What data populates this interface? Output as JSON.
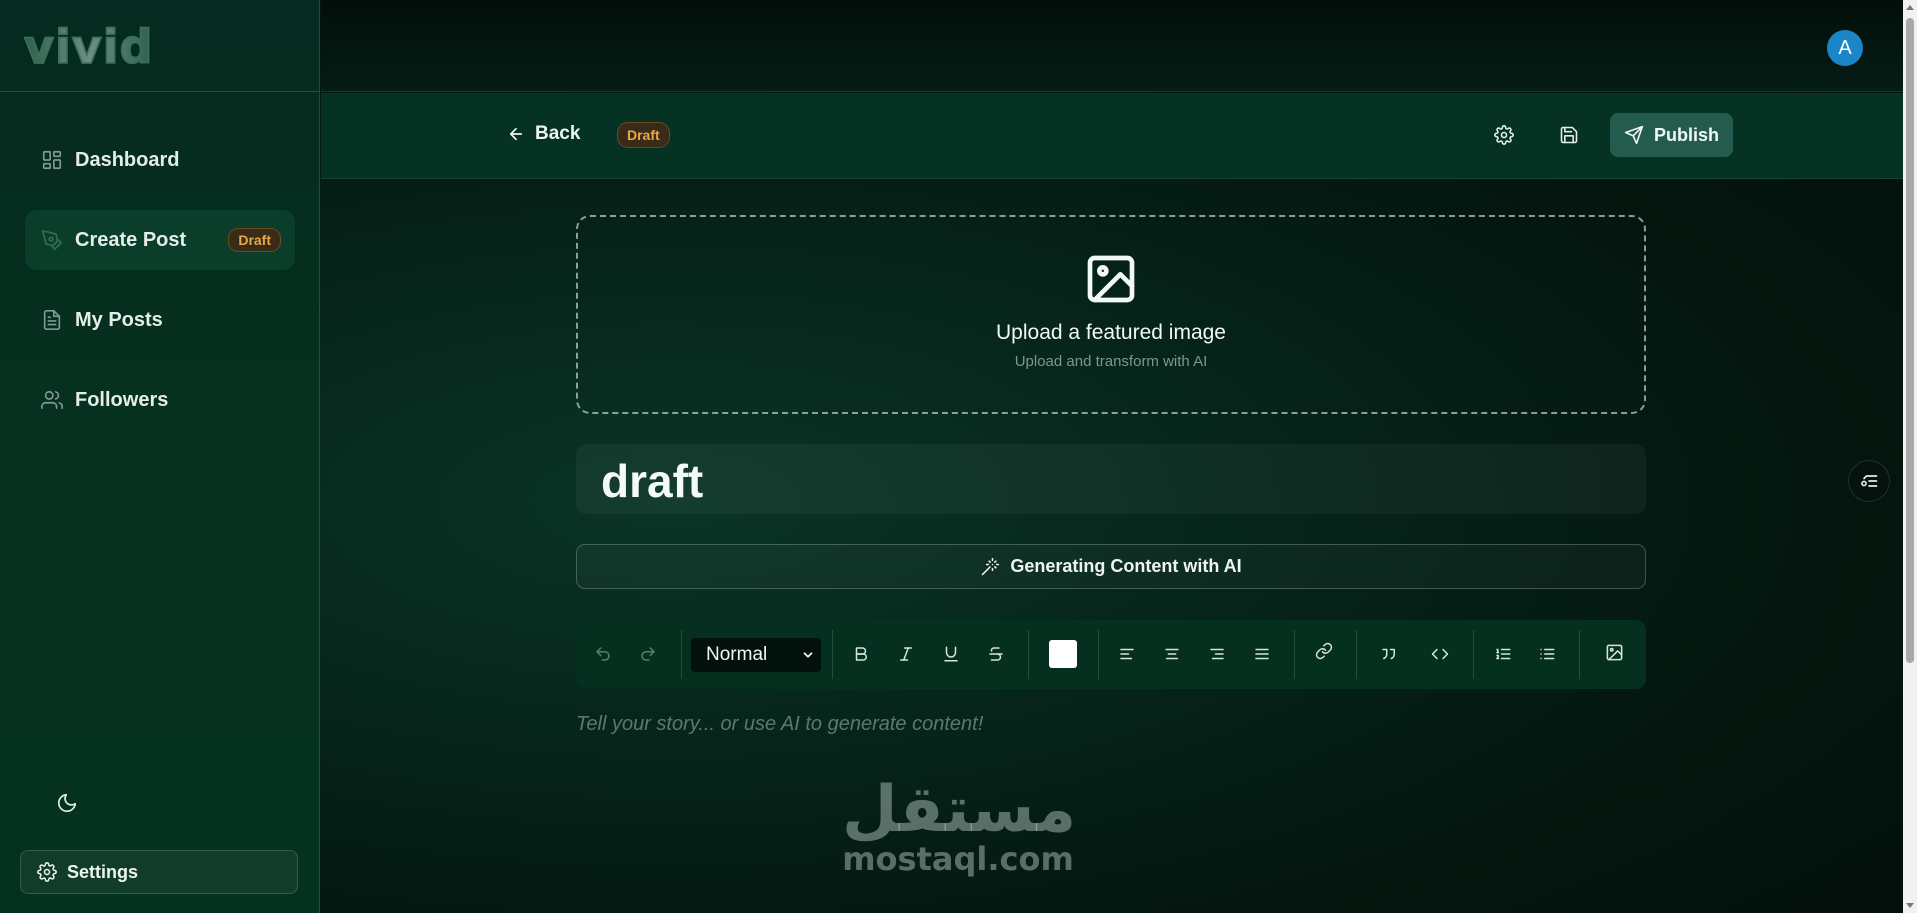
{
  "app": {
    "logo_text": "vivid"
  },
  "sidebar": {
    "items": [
      {
        "label": "Dashboard",
        "icon": "dashboard-icon"
      },
      {
        "label": "Create Post",
        "icon": "pen-icon",
        "badge": "Draft",
        "active": true
      },
      {
        "label": "My Posts",
        "icon": "document-icon"
      },
      {
        "label": "Followers",
        "icon": "users-icon"
      }
    ],
    "theme_toggle_icon": "moon-icon",
    "settings_label": "Settings"
  },
  "topbar": {
    "avatar_initial": "A"
  },
  "editor_header": {
    "back_label": "Back",
    "status_badge": "Draft",
    "publish_label": "Publish"
  },
  "upload": {
    "title": "Upload a featured image",
    "subtitle": "Upload and transform with AI"
  },
  "post": {
    "title": "draft"
  },
  "ai_button": {
    "label": "Generating Content with AI"
  },
  "toolbar": {
    "block_format": "Normal",
    "text_color": "#ffffff"
  },
  "editor": {
    "placeholder": "Tell your story... or use AI to generate content!"
  },
  "watermark": {
    "arabic": "مستقل",
    "latin": "mostaql.com"
  },
  "colors": {
    "accent": "#235c4f",
    "badge_text": "#e5a948",
    "avatar": "#1a86c8"
  }
}
